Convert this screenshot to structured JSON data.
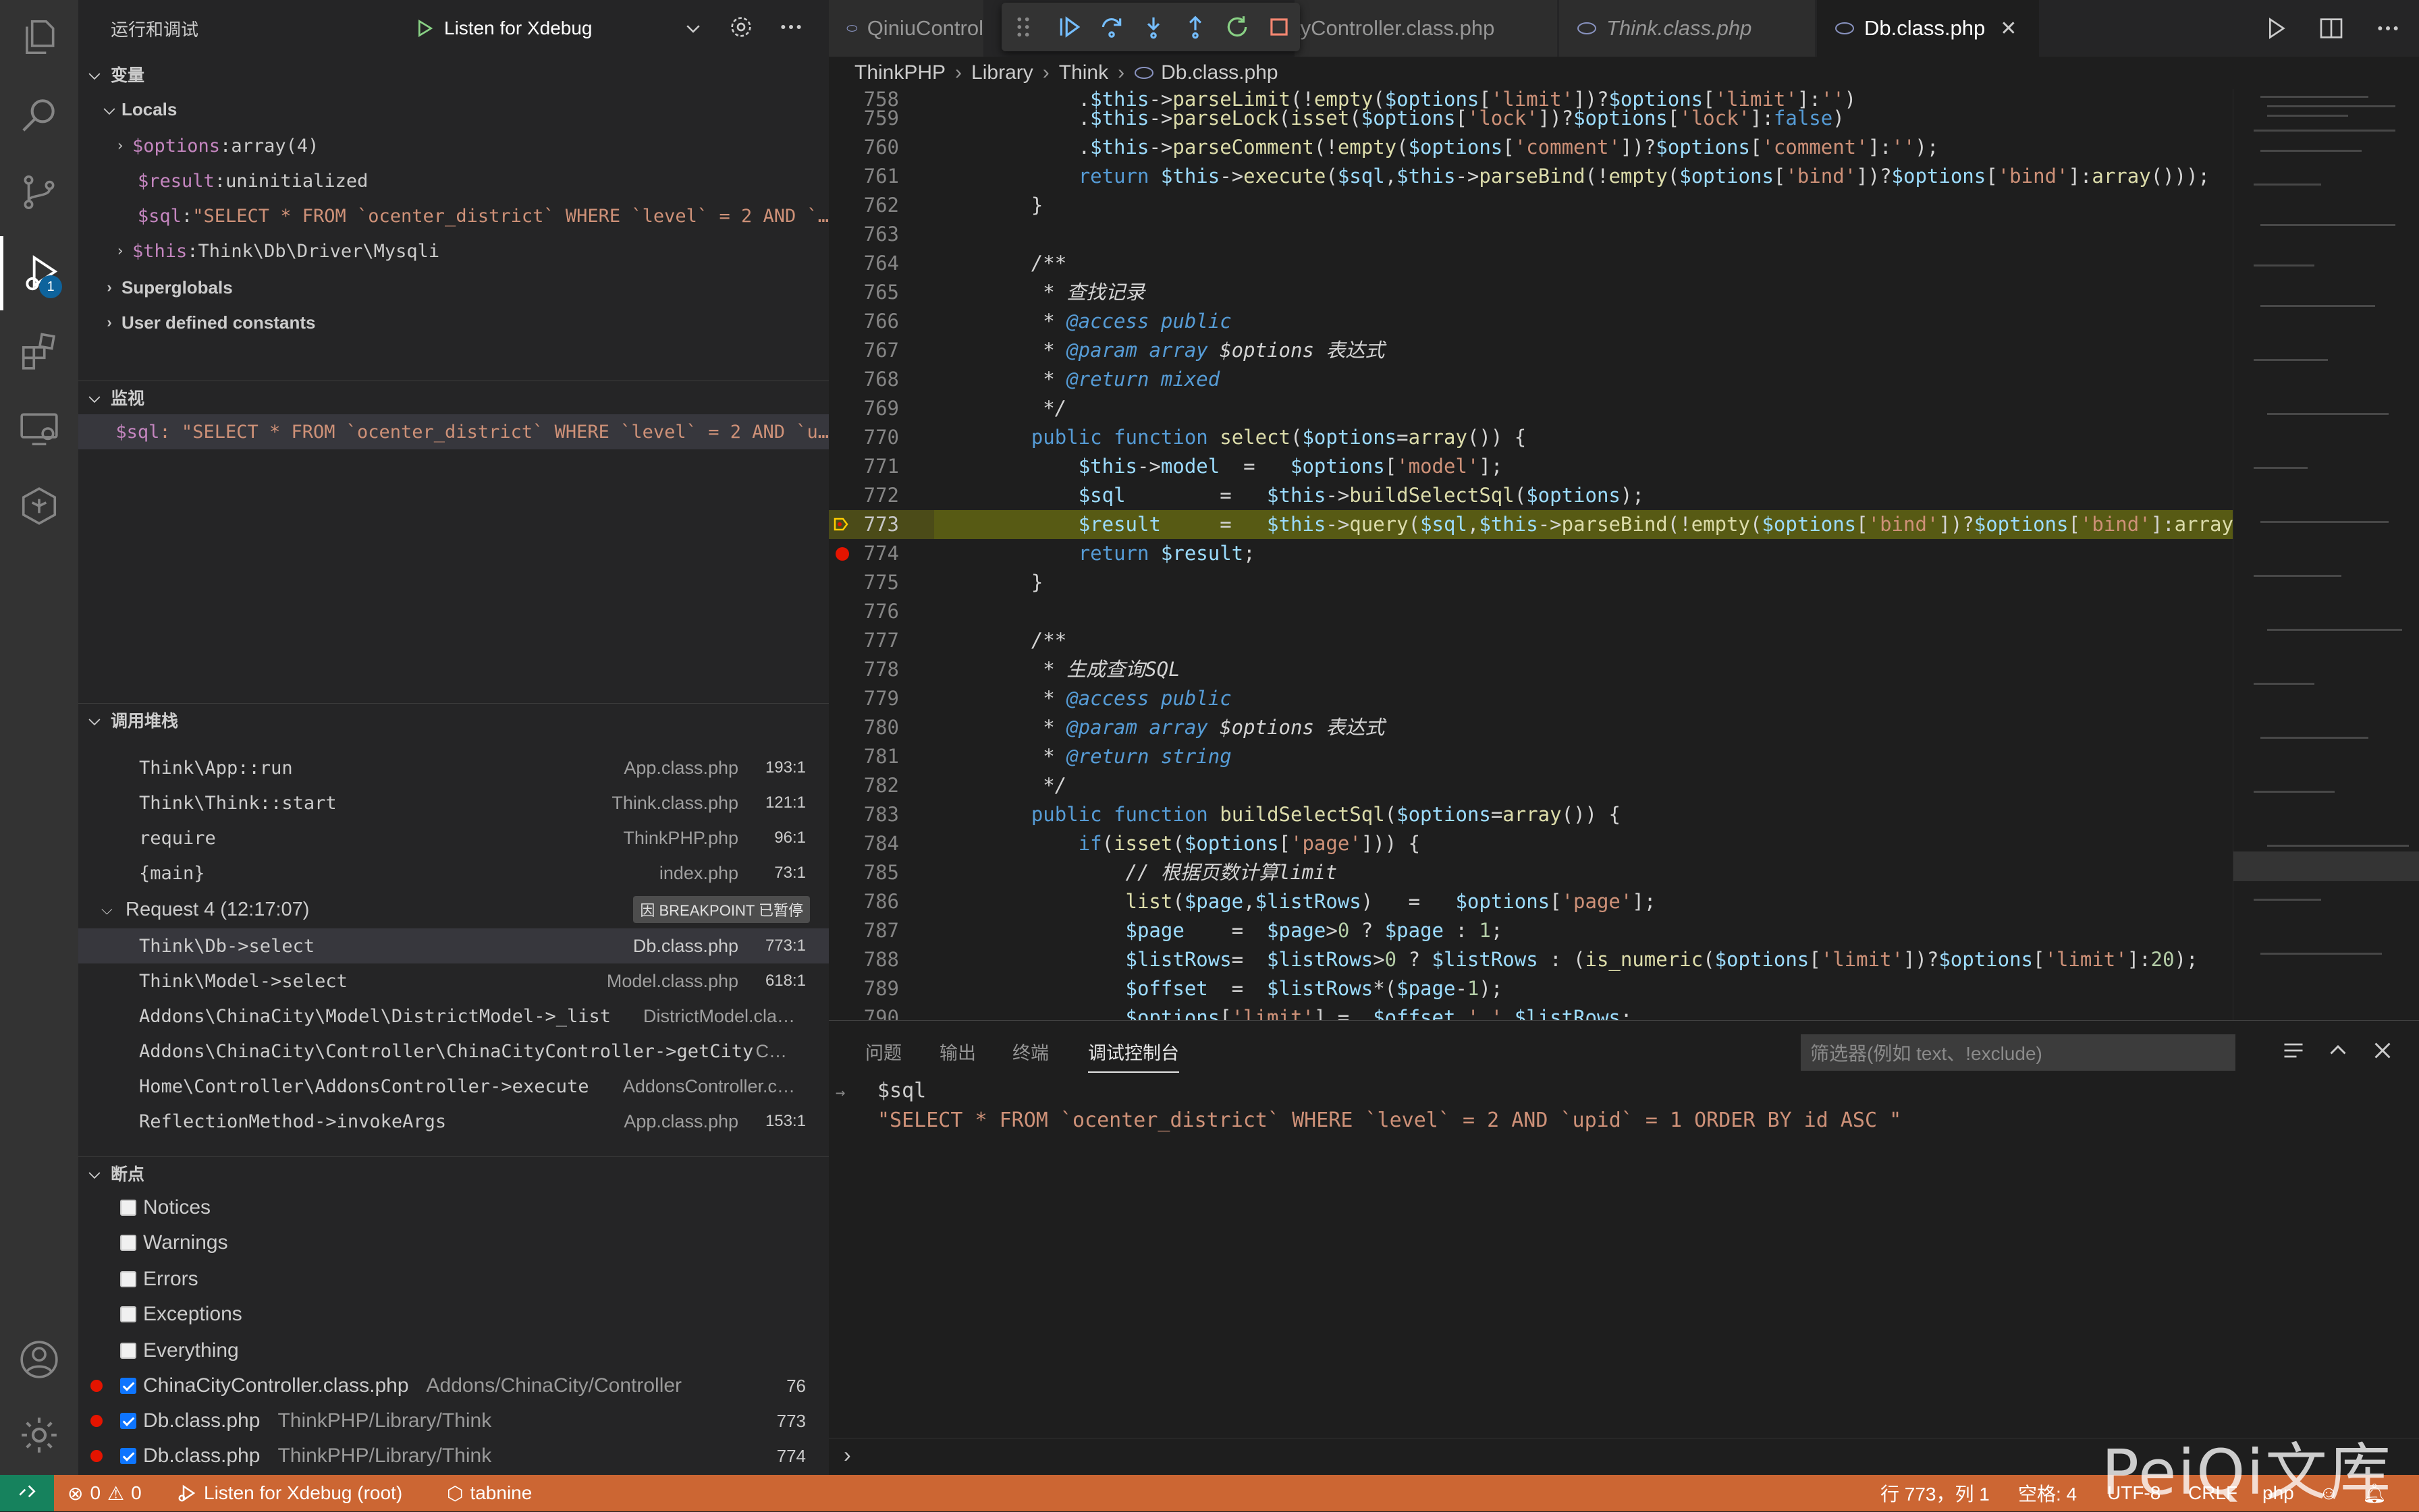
{
  "sidebar": {
    "title": "运行和调试",
    "config_name": "Listen for Xdebug",
    "variables_title": "变量",
    "locals_label": "Locals",
    "locals": [
      {
        "name": "$options",
        "sep": ": ",
        "value": "array(4)",
        "expandable": true
      },
      {
        "name": "$result",
        "sep": ": ",
        "value": "uninitialized",
        "expandable": false
      },
      {
        "name": "$sql",
        "sep": ": ",
        "value": "\"SELECT * FROM `ocenter_district` WHERE `level` = 2 AND `…",
        "expandable": false
      },
      {
        "name": "$this",
        "sep": ": ",
        "value": "Think\\Db\\Driver\\Mysqli",
        "expandable": true
      }
    ],
    "superglobals_label": "Superglobals",
    "constants_label": "User defined constants",
    "watch_title": "监视",
    "watch_expr": "$sql",
    "watch_value": ": \"SELECT * FROM `ocenter_district` WHERE `level` = 2 AND `u…",
    "callstack_title": "调用堆栈",
    "stack_top": [
      {
        "fn": "Think\\App::run",
        "file": "App.class.php",
        "line": "193:1"
      },
      {
        "fn": "Think\\Think::start",
        "file": "Think.class.php",
        "line": "121:1"
      },
      {
        "fn": "require",
        "file": "ThinkPHP.php",
        "line": "96:1"
      },
      {
        "fn": "{main}",
        "file": "index.php",
        "line": "73:1"
      }
    ],
    "request_label": "Request 4 (12:17:07)",
    "request_badge": "因 BREAKPOINT 已暂停",
    "stack_frames": [
      {
        "fn": "Think\\Db->select",
        "file": "Db.class.php",
        "line": "773:1"
      },
      {
        "fn": "Think\\Model->select",
        "file": "Model.class.php",
        "line": "618:1"
      },
      {
        "fn": "Addons\\ChinaCity\\Model\\DistrictModel->_list",
        "file": "DistrictModel.cla…",
        "line": ""
      },
      {
        "fn": "Addons\\ChinaCity\\Controller\\ChinaCityController->getCity",
        "file": "C…",
        "line": ""
      },
      {
        "fn": "Home\\Controller\\AddonsController->execute",
        "file": "AddonsController.c…",
        "line": ""
      },
      {
        "fn": "ReflectionMethod->invokeArgs",
        "file": "App.class.php",
        "line": "153:1"
      }
    ],
    "breakpoints_title": "断点",
    "bp_options": [
      "Notices",
      "Warnings",
      "Errors",
      "Exceptions",
      "Everything"
    ],
    "breakpoints": [
      {
        "file": "ChinaCityController.class.php",
        "path": "Addons/ChinaCity/Controller",
        "line": "76"
      },
      {
        "file": "Db.class.php",
        "path": "ThinkPHP/Library/Think",
        "line": "773"
      },
      {
        "file": "Db.class.php",
        "path": "ThinkPHP/Library/Think",
        "line": "774"
      }
    ]
  },
  "tabs": [
    {
      "label": "QiniuControl"
    },
    {
      "label": "tyController.class.php"
    },
    {
      "label": "Think.class.php"
    },
    {
      "label": "Db.class.php"
    }
  ],
  "breadcrumb": [
    "ThinkPHP",
    "Library",
    "Think",
    "Db.class.php"
  ],
  "panel": {
    "tabs": [
      "问题",
      "输出",
      "终端",
      "调试控制台"
    ],
    "filter_placeholder": "筛选器(例如 text、!exclude)",
    "console_expr": "$sql",
    "console_result": "\"SELECT * FROM `ocenter_district` WHERE `level` = 2 AND `upid` = 1 ORDER BY id ASC \""
  },
  "status": {
    "errors": "0",
    "warnings": "0",
    "debug_label": "Listen for Xdebug (root)",
    "tabnine": "tabnine",
    "position": "行 773，列 1",
    "spaces": "空格: 4",
    "encoding": "UTF-8",
    "eol": "CRLF",
    "lang": "php"
  },
  "activity_badge": "1",
  "watermark": "PeiQi文库",
  "colors": {
    "statusbar": "#cc6633",
    "current_line": "#575a14",
    "breakpoint": "#e51400",
    "accent": "#0e639c"
  }
}
